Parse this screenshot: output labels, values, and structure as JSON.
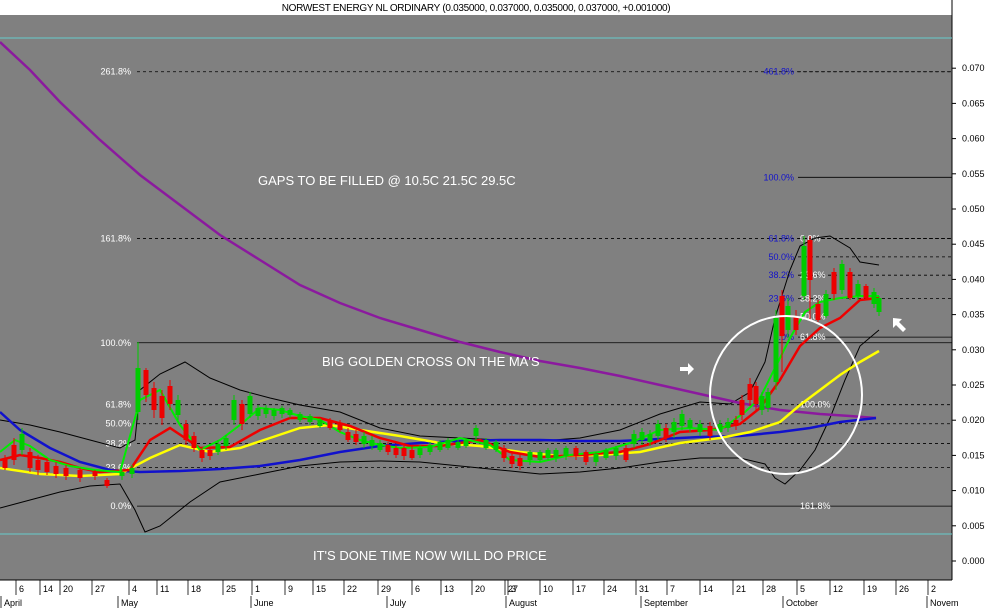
{
  "chart_data": {
    "type": "candlestick",
    "title": "NORWEST ENERGY NL ORDINARY (0.035000, 0.037000, 0.035000, 0.037000, +0.001000)",
    "y_ticks": [
      "0.000",
      "0.005",
      "0.010",
      "0.015",
      "0.020",
      "0.025",
      "0.030",
      "0.035",
      "0.040",
      "0.045",
      "0.050",
      "0.055",
      "0.060",
      "0.065",
      "0.070"
    ],
    "y_values": [
      0.0,
      0.005,
      0.01,
      0.015,
      0.02,
      0.025,
      0.03,
      0.035,
      0.04,
      0.045,
      0.05,
      0.055,
      0.06,
      0.065,
      0.07
    ],
    "ylim": [
      -0.002,
      0.077
    ],
    "x_day_ticks": [
      "6",
      "14",
      "20",
      "27",
      "4",
      "11",
      "18",
      "25",
      "1",
      "9",
      "15",
      "22",
      "29",
      "6",
      "13",
      "20",
      "27",
      "3",
      "10",
      "17",
      "24",
      "31",
      "7",
      "14",
      "21",
      "28",
      "5",
      "12",
      "19",
      "26",
      "2"
    ],
    "x_month_labels": [
      "April",
      "May",
      "June",
      "July",
      "August",
      "September",
      "October",
      "Novem"
    ],
    "annotations": {
      "gaps": "GAPS TO BE FILLED @ 10.5C 21.5C 29.5C",
      "cross": "BIG GOLDEN CROSS ON THE MA'S",
      "done": "IT'S DONE TIME NOW WILL DO PRICE"
    },
    "fib_left": [
      {
        "label": "261.8%",
        "value": 0.0695
      },
      {
        "label": "161.8%",
        "value": 0.0458
      },
      {
        "label": "100.0%",
        "value": 0.031
      },
      {
        "label": "61.8%",
        "value": 0.0222
      },
      {
        "label": "50.0%",
        "value": 0.0195
      },
      {
        "label": "38.2%",
        "value": 0.0167
      },
      {
        "label": "23.6%",
        "value": 0.0133
      },
      {
        "label": "0.0%",
        "value": 0.0078
      }
    ],
    "fib_right_blue": [
      {
        "label": "461.8%",
        "value": 0.0695
      },
      {
        "label": "100.0%",
        "value": 0.0545
      },
      {
        "label": "61.8%",
        "value": 0.0458
      },
      {
        "label": "50.0%",
        "value": 0.0432
      },
      {
        "label": "38.2%",
        "value": 0.0406
      },
      {
        "label": "23.6%",
        "value": 0.0373
      },
      {
        "label": "0.0%",
        "value": 0.0318
      }
    ],
    "fib_right_white": [
      {
        "label": "0.0%",
        "value": 0.0458
      },
      {
        "label": "23.6%",
        "value": 0.0406
      },
      {
        "label": "38.2%",
        "value": 0.0373
      },
      {
        "label": "50.0%",
        "value": 0.0347
      },
      {
        "label": "61.8%",
        "value": 0.0318
      },
      {
        "label": "100.0%",
        "value": 0.0222
      },
      {
        "label": "161.8%",
        "value": 0.0078
      }
    ],
    "colors": {
      "background": "#808080",
      "axis_panel": "#ffffff",
      "up_candle": "#00cc00",
      "down_candle": "#ee0000",
      "ma_fast": "#00ee00",
      "ma_short": "#ee0000",
      "ma_medium": "#ffff00",
      "ma_long": "#1111cc",
      "ma_very_long": "#8b1a9e",
      "bollinger": "#000000",
      "cyan_line": "#66cccc",
      "fib_blue": "#1111cc"
    }
  }
}
